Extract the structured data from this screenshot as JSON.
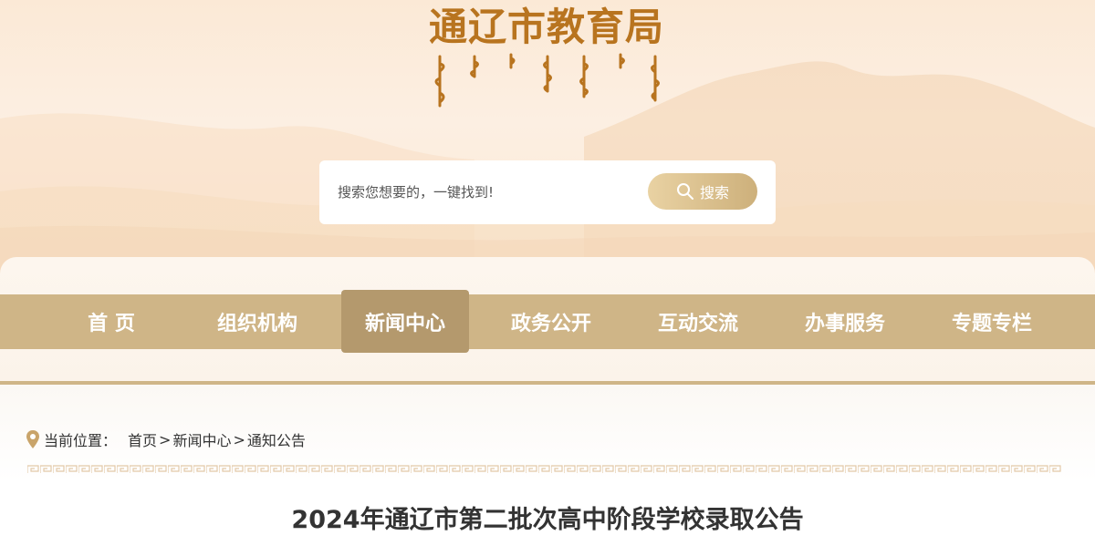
{
  "site": {
    "title": "通辽市教育局",
    "subtitle_script_label": "ᠲᠦᠩᠯᠢᠶᠣ ᠬᠣᠲᠠ ᠶᠢᠨ ᠰᠤᠷᠭᠠᠨ ᠬᠦᠮᠦᠵᠢᠯ ᠤᠨ ᠲᠣᠪᠴᠢᠶ᠎ᠠ"
  },
  "search": {
    "placeholder": "搜索您想要的，一键找到!",
    "button_label": "搜索",
    "icon": "search-icon"
  },
  "nav": {
    "items": [
      {
        "label": "首 页",
        "active": false
      },
      {
        "label": "组织机构",
        "active": false
      },
      {
        "label": "新闻中心",
        "active": true
      },
      {
        "label": "政务公开",
        "active": false
      },
      {
        "label": "互动交流",
        "active": false
      },
      {
        "label": "办事服务",
        "active": false
      },
      {
        "label": "专题专栏",
        "active": false
      }
    ]
  },
  "breadcrumb": {
    "icon": "location-pin-icon",
    "label": "当前位置：",
    "items": [
      "首页",
      "新闻中心",
      "通知公告"
    ],
    "separator": ">"
  },
  "article": {
    "title": "2024年通辽市第二批次高中阶段学校录取公告"
  },
  "colors": {
    "brand_gold": "#b8741f",
    "nav_bar": "#cfb587",
    "nav_active": "#b4996d",
    "search_button": "#d9bf8c"
  }
}
